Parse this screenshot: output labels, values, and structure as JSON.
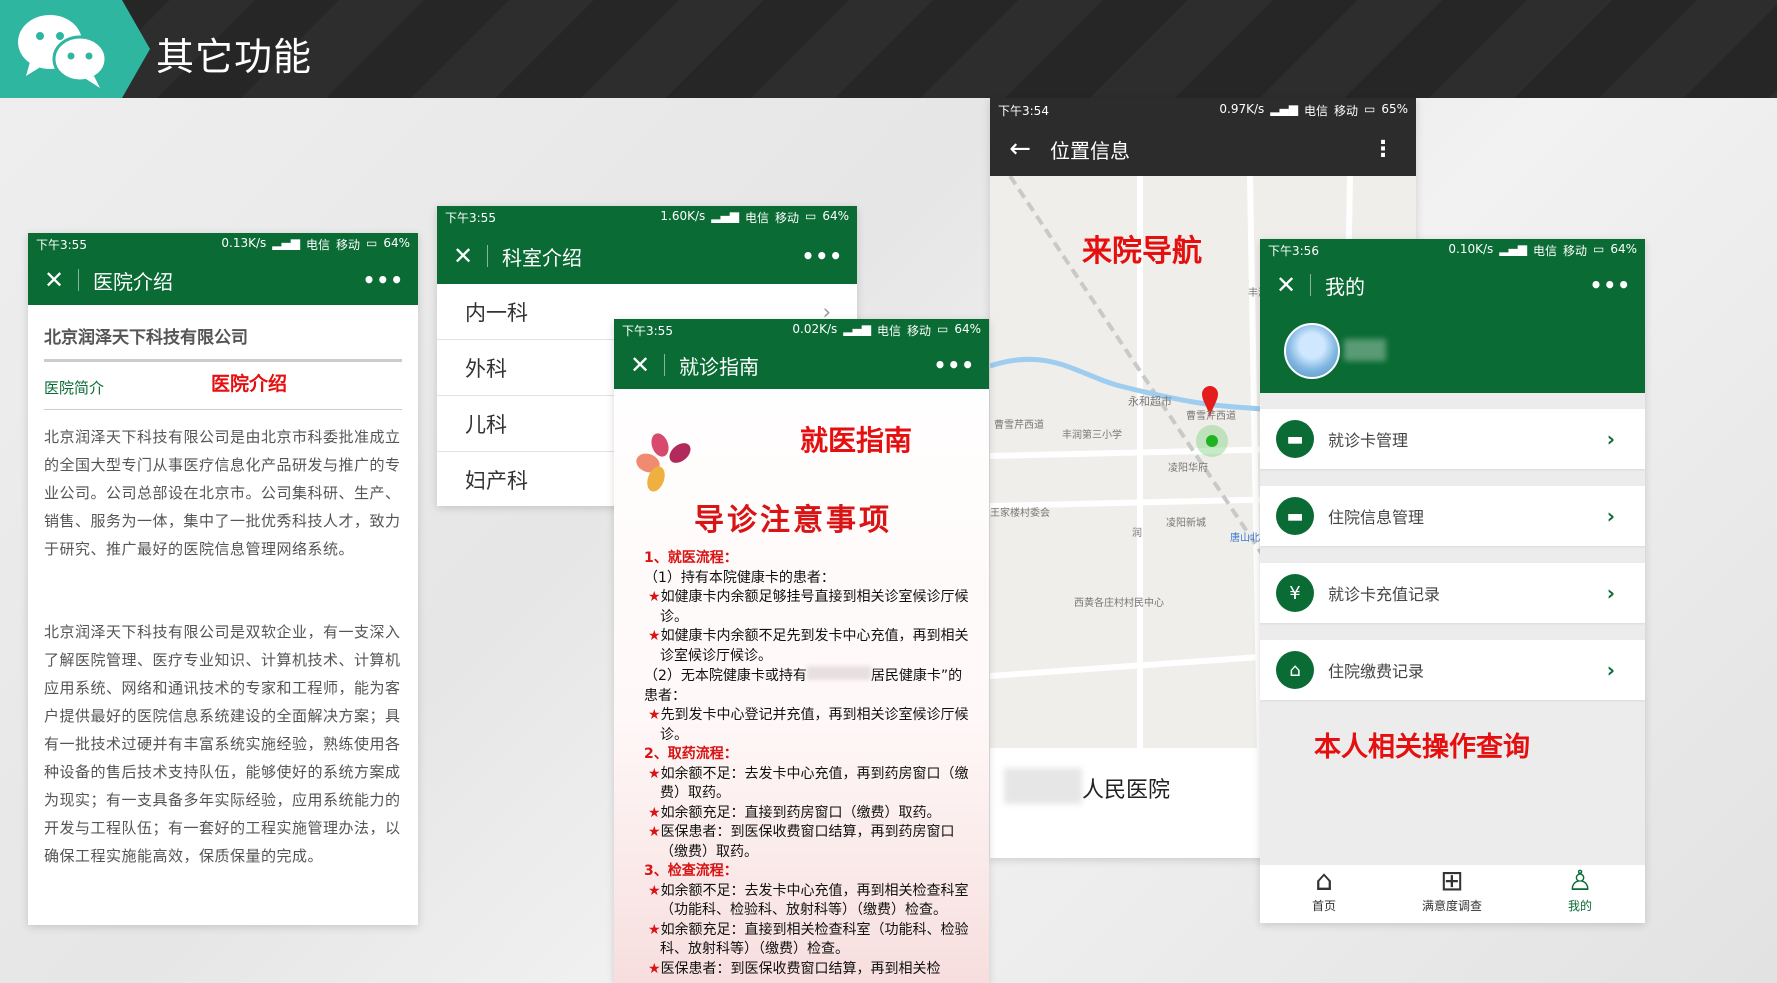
{
  "header": {
    "title": "其它功能",
    "logo_icon": "wechat-icon"
  },
  "status_bars": {
    "p1": {
      "time": "下午3:55",
      "speed": "0.13K/s",
      "carrier1": "电信",
      "carrier2": "移动",
      "battery": "64%"
    },
    "p2": {
      "time": "下午3:55",
      "speed": "1.60K/s",
      "carrier1": "电信",
      "carrier2": "移动",
      "battery": "64%"
    },
    "p3": {
      "time": "下午3:55",
      "speed": "0.02K/s",
      "carrier1": "电信",
      "carrier2": "移动",
      "battery": "64%"
    },
    "p4": {
      "time": "下午3:54",
      "speed": "0.97K/s",
      "carrier1": "电信",
      "carrier2": "移动",
      "battery": "65%"
    },
    "p5": {
      "time": "下午3:56",
      "speed": "0.10K/s",
      "carrier1": "电信",
      "carrier2": "移动",
      "battery": "64%"
    }
  },
  "hospital_intro": {
    "nav_title": "医院介绍",
    "company": "北京润泽天下科技有限公司",
    "tab": "医院简介",
    "annotation": "医院介绍",
    "para1": "北京润泽天下科技有限公司是由北京市科委批准成立的全国大型专门从事医疗信息化产品研发与推广的专业公司。公司总部设在北京市。公司集科研、生产、销售、服务为一体，集中了一批优秀科技人才，致力于研究、推广最好的医院信息管理网络系统。",
    "para2": "北京润泽天下科技有限公司是双软企业，有一支深入了解医院管理、医疗专业知识、计算机技术、计算机应用系统、网络和通讯技术的专家和工程师，能为客户提供最好的医院信息系统建设的全面解决方案；具有一批技术过硬并有丰富系统实施经验，熟练使用各种设备的售后技术支持队伍，能够使好的系统方案成为现实；有一支具备多年实际经验，应用系统能力的开发与工程队伍；有一套好的工程实施管理办法，以确保工程实施能高效，保质保量的完成。"
  },
  "departments": {
    "nav_title": "科室介绍",
    "items": [
      "内一科",
      "外科",
      "儿科",
      "妇产科"
    ]
  },
  "guide": {
    "nav_title": "就诊指南",
    "annotation": "就医指南",
    "heading": "导诊注意事项",
    "s1": "1、就医流程：",
    "s1a": "（1）持有本院健康卡的患者：",
    "s1a1": "如健康卡内余额足够挂号直接到相关诊室候诊厅候诊。",
    "s1a2": "如健康卡内余额不足先到发卡中心充值，再到相关诊室候诊厅候诊。",
    "s1b_pre": "（2）无本院健康卡或持有",
    "s1b_post": "居民健康卡”的患者：",
    "s1b1": "先到发卡中心登记并充值，再到相关诊室候诊厅候诊。",
    "s2": "2、取药流程：",
    "s2a": "如余额不足：去发卡中心充值，再到药房窗口（缴费）取药。",
    "s2b": "如余额充足：直接到药房窗口（缴费）取药。",
    "s2c": "医保患者：到医保收费窗口结算，再到药房窗口（缴费）取药。",
    "s3": "3、检查流程：",
    "s3a": "如余额不足：去发卡中心充值，再到相关检查科室（功能科、检验科、放射科等）（缴费）检查。",
    "s3b": "如余额充足：直接到相关检查科室（功能科、检验科、放射科等）（缴费）检查。",
    "s3c": "医保患者：到医保收费窗口结算，再到相关检"
  },
  "location": {
    "nav_title": "位置信息",
    "annotation": "来院导航",
    "hospital_suffix": "人民医院",
    "map_labels": [
      "永和超市",
      "丰润第三小学",
      "曹雪芹西道",
      "曹雪芹西道",
      "凌阳华府",
      "凌阳新城",
      "西黄各庄村村民中心",
      "王家楼村委会",
      "唐山北站",
      "润",
      "丰润"
    ]
  },
  "mine": {
    "nav_title": "我的",
    "annotation": "本人相关操作查询",
    "menu": [
      {
        "label": "就诊卡管理",
        "icon": "card-icon"
      },
      {
        "label": "住院信息管理",
        "icon": "card-icon"
      },
      {
        "label": "就诊卡充值记录",
        "icon": "yen-icon"
      },
      {
        "label": "住院缴费记录",
        "icon": "bed-icon"
      }
    ],
    "tabs": [
      {
        "label": "首页"
      },
      {
        "label": "满意度调查"
      },
      {
        "label": "我的"
      }
    ],
    "accent": "#0a6b34"
  }
}
